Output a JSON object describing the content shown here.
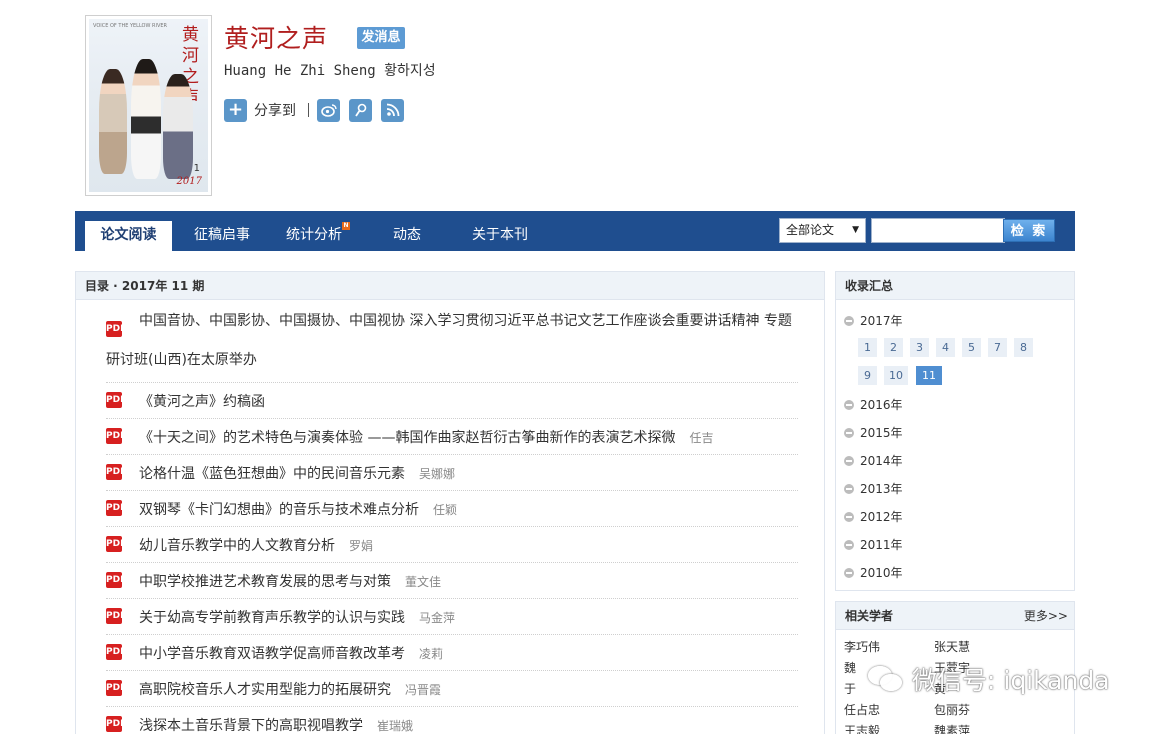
{
  "journal": {
    "title": "黄河之声",
    "message_button": "发消息",
    "subtitle": "Huang He Zhi Sheng 황하지성",
    "share_label": "分享到",
    "cover": {
      "vertical_title": "黄河之声",
      "issue_number": "1",
      "year": "2017",
      "top_text": "VOICE OF THE YELLOW RIVER"
    }
  },
  "nav": {
    "tabs": [
      {
        "label": "论文阅读",
        "active": true
      },
      {
        "label": "征稿启事"
      },
      {
        "label": "统计分析",
        "badge": "N"
      },
      {
        "label": "动态"
      },
      {
        "label": "关于本刊"
      }
    ],
    "select_value": "全部论文",
    "search_button": "检 索"
  },
  "toc": {
    "header": "目录 · 2017年  11  期",
    "items": [
      {
        "title": "中国音协、中国影协、中国摄协、中国视协  深入学习贯彻习近平总书记文艺工作座谈会重要讲话精神  专题",
        "title_line2": "研讨班(山西)在太原举办",
        "author": ""
      },
      {
        "title": "《黄河之声》约稿函",
        "author": ""
      },
      {
        "title": "《十天之间》的艺术特色与演奏体验  ——韩国作曲家赵哲衍古筝曲新作的表演艺术探微",
        "author": "任吉"
      },
      {
        "title": "论格什温《蓝色狂想曲》中的民间音乐元素",
        "author": "吴娜娜"
      },
      {
        "title": "双钢琴《卡门幻想曲》的音乐与技术难点分析",
        "author": "任颖"
      },
      {
        "title": "幼儿音乐教学中的人文教育分析",
        "author": "罗娟"
      },
      {
        "title": "中职学校推进艺术教育发展的思考与对策",
        "author": "董文佳"
      },
      {
        "title": "关于幼高专学前教育声乐教学的认识与实践",
        "author": "马金萍"
      },
      {
        "title": "中小学音乐教育双语教学促高师音教改革考",
        "author": "凌莉"
      },
      {
        "title": "高职院校音乐人才实用型能力的拓展研究",
        "author": "冯晋霞"
      },
      {
        "title": "浅探本土音乐背景下的高职视唱教学",
        "author": "崔瑞娥"
      }
    ]
  },
  "archive": {
    "header": "收录汇总",
    "current_year": "2017年",
    "issues": [
      "1",
      "2",
      "3",
      "4",
      "5",
      "7",
      "8",
      "9",
      "10",
      "11"
    ],
    "active_issue": "11",
    "years": [
      "2016年",
      "2015年",
      "2014年",
      "2013年",
      "2012年",
      "2011年",
      "2010年"
    ]
  },
  "scholars": {
    "header": "相关学者",
    "more": "更多>>",
    "names": [
      "李巧伟",
      "张天慧",
      "魏",
      "王蒙宇",
      "于",
      "黄",
      "任占忠",
      "包丽芬",
      "王志毅",
      "魏素萍"
    ]
  },
  "watermark": {
    "text": "微信号: iqikanda"
  },
  "colors": {
    "brand_red": "#b01e1e",
    "nav_blue": "#1f4e8f",
    "accent_blue": "#4f8ed1",
    "pdf_red": "#d72020"
  }
}
